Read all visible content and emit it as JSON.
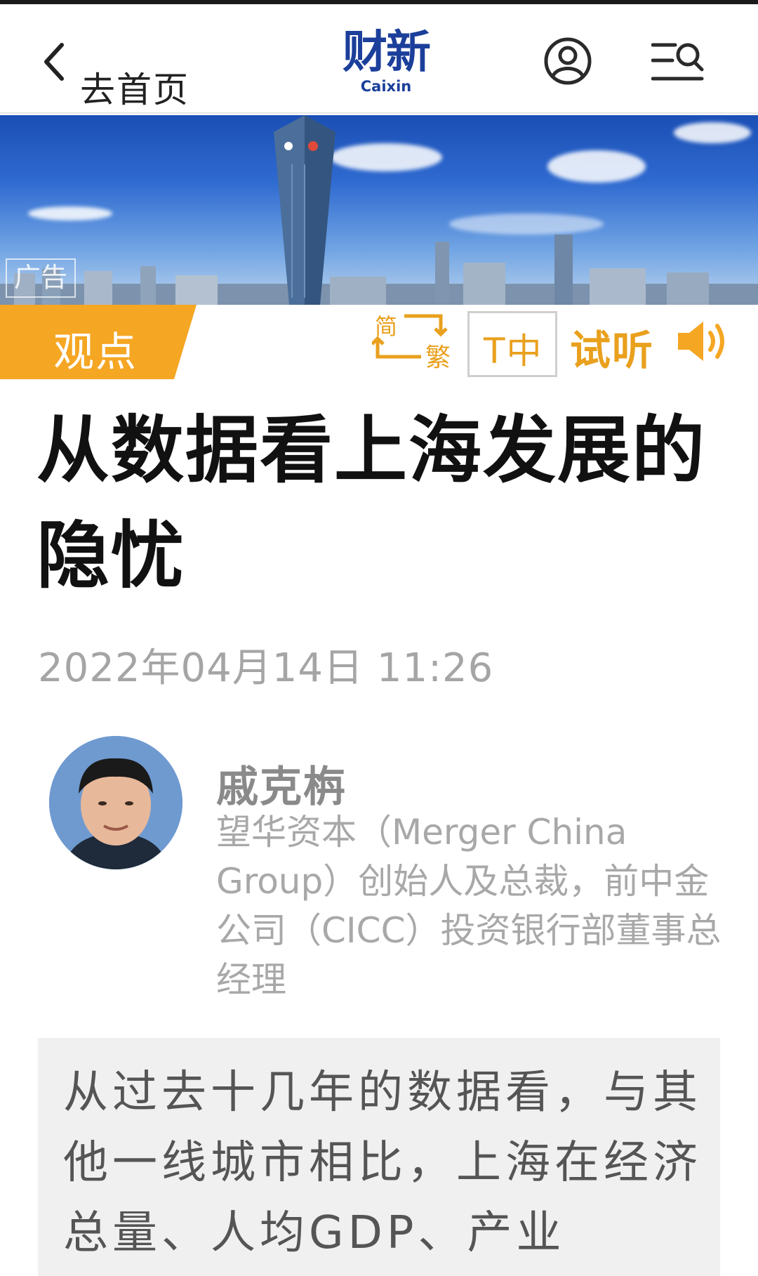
{
  "header": {
    "back_label": "去首页",
    "logo_cn": "财新",
    "logo_en": "Caixin"
  },
  "banner": {
    "ad_label": "广告"
  },
  "toolbar": {
    "category": "观点",
    "convert_simplified": "简",
    "convert_traditional": "繁",
    "font_size_label": "T中",
    "listen_label": "试听"
  },
  "article": {
    "title": "从数据看上海发展的隐忧",
    "date": "2022年04月14日 11:26",
    "author": {
      "name": "戚克栴",
      "bio": "望华资本（Merger China Group）创始人及总裁，前中金公司（CICC）投资银行部董事总经理"
    },
    "summary": "从过去十几年的数据看，与其他一线城市相比，上海在经济总量、人均GDP、产业"
  },
  "colors": {
    "accent_orange": "#f5a623",
    "brand_blue": "#1b3f9a",
    "text_gray": "#a5a5a5"
  },
  "icons": [
    "chevron-left-icon",
    "user-icon",
    "menu-search-icon",
    "convert-arrows-icon",
    "speaker-icon"
  ]
}
